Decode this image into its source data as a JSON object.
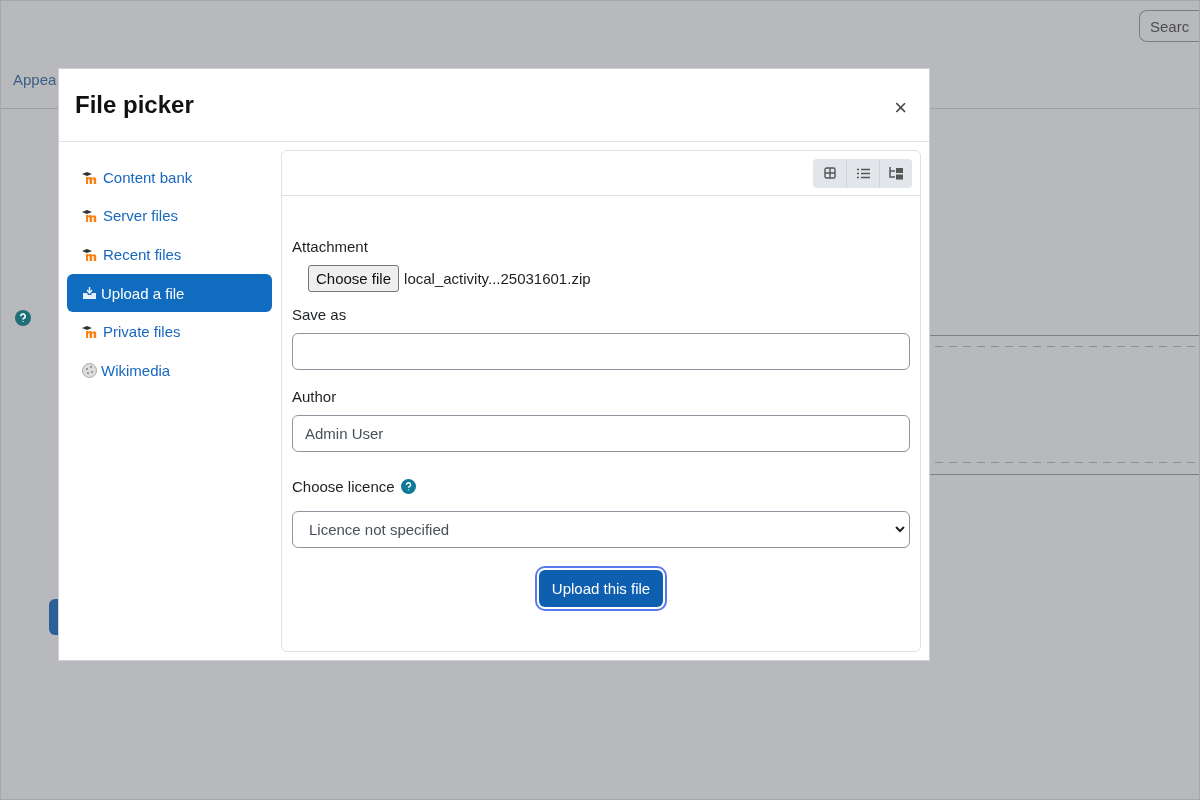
{
  "page": {
    "search_placeholder": "Searc",
    "nav_link": "Appea"
  },
  "dialog": {
    "title": "File picker",
    "close": "×",
    "repositories": [
      {
        "label": "Content bank",
        "kind": "moodle",
        "selected": false
      },
      {
        "label": "Server files",
        "kind": "moodle",
        "selected": false
      },
      {
        "label": "Recent files",
        "kind": "moodle",
        "selected": false
      },
      {
        "label": "Upload a file",
        "kind": "upload",
        "selected": true
      },
      {
        "label": "Private files",
        "kind": "moodle",
        "selected": false
      },
      {
        "label": "Wikimedia",
        "kind": "wiki",
        "selected": false
      }
    ],
    "form": {
      "attachment_label": "Attachment",
      "choose_button": "Choose file",
      "chosen_file": "local_activity...25031601.zip",
      "save_as_label": "Save as",
      "author_label": "Author",
      "author_value": "Admin User",
      "licence_label": "Choose licence",
      "licence_value": "Licence not specified",
      "upload_button": {
        "label": "Upload this file",
        "focused": true
      }
    }
  }
}
